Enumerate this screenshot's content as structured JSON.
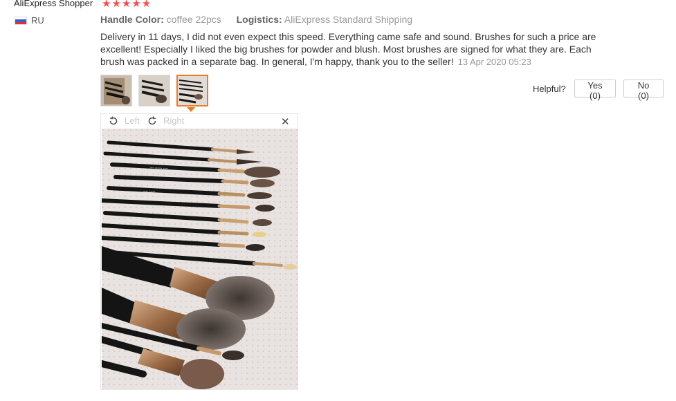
{
  "reviewer": {
    "name": "AliExpress Shopper",
    "stars": "★★★★★",
    "country": "RU"
  },
  "attributes": [
    {
      "key": "Handle Color:",
      "value": "coffee 22pcs"
    },
    {
      "key": "Logistics:",
      "value": "AliExpress Standard Shipping"
    }
  ],
  "review": {
    "text": "Delivery in 11 days, I did not even expect this speed. Everything came safe and sound. Brushes for such a price are excellent! Especially I liked the big brushes for powder and blush. Most brushes are signed for what they are. Each brush was packed in a separate bag. In general, I'm happy, thank you to the seller!",
    "date": "13 Apr 2020 05:23"
  },
  "thumbnails": [
    {
      "name": "review-photo-1",
      "selected": false
    },
    {
      "name": "review-photo-2",
      "selected": false
    },
    {
      "name": "review-photo-3",
      "selected": true
    }
  ],
  "helpful": {
    "label": "Helpful?",
    "yes_label": "Yes (0)",
    "no_label": "No (0)"
  },
  "viewer": {
    "rotate_left_label": "Left",
    "rotate_right_label": "Right",
    "close_glyph": "✕"
  },
  "colors": {
    "star": "#ff4747",
    "accent": "#f07b22",
    "muted_text": "#999999"
  }
}
